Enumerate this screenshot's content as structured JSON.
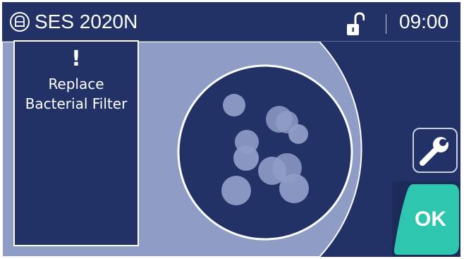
{
  "header": {
    "device_name": "SES 2020N",
    "time": "09:00",
    "logo_icon": "circled-lettermark-logo",
    "lock_icon": "unlocked-padlock-icon"
  },
  "alarm": {
    "icon": "!",
    "message": "Replace Bacterial Filter"
  },
  "buttons": {
    "tools_icon": "wrench-icon",
    "ok_label": "OK"
  },
  "colors": {
    "background": "#223266",
    "drum_panel": "#8f9cc6",
    "drum_window": "#223266",
    "bubbles": "#8f9cc6",
    "ok_button": "#2fc6b0",
    "text": "#ffffff"
  }
}
